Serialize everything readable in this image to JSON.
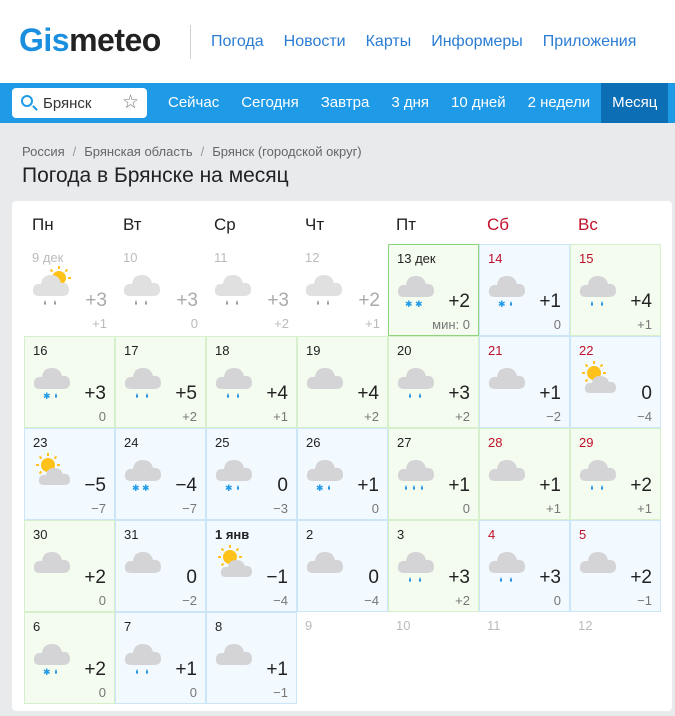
{
  "header": {
    "logo_gis": "Gis",
    "logo_meteo": "meteo",
    "nav": [
      "Погода",
      "Новости",
      "Карты",
      "Информеры",
      "Приложения"
    ]
  },
  "toolbar": {
    "search_value": "Брянск",
    "tabs": [
      "Сейчас",
      "Сегодня",
      "Завтра",
      "3 дня",
      "10 дней",
      "2 недели",
      "Месяц"
    ],
    "active_tab": "Месяц"
  },
  "breadcrumb": [
    "Россия",
    "Брянская область",
    "Брянск (городской округ)"
  ],
  "page_title": "Погода в Брянске на месяц",
  "weekdays": [
    "Пн",
    "Вт",
    "Ср",
    "Чт",
    "Пт",
    "Сб",
    "Вс"
  ],
  "min_label": "мин:",
  "colors": {
    "brand_blue": "#1f9ae6",
    "active_tab": "#0c6fb6",
    "weekend_red": "#c0102a",
    "link_blue": "#2b7cd3"
  },
  "days": [
    {
      "date": "9 дек",
      "tmax": "+3",
      "tmin": "+1",
      "icon": "cloud-sun-rain-icon",
      "state": "past"
    },
    {
      "date": "10",
      "tmax": "+3",
      "tmin": "0",
      "icon": "cloud-rain-icon",
      "state": "past"
    },
    {
      "date": "11",
      "tmax": "+3",
      "tmin": "+2",
      "icon": "cloud-rain-icon",
      "state": "past"
    },
    {
      "date": "12",
      "tmax": "+2",
      "tmin": "+1",
      "icon": "cloud-rain-icon",
      "state": "past"
    },
    {
      "date": "13 дек",
      "tmax": "+2",
      "tmin": "0",
      "icon": "cloud-snow-icon",
      "state": "today"
    },
    {
      "date": "14",
      "tmax": "+1",
      "tmin": "0",
      "icon": "cloud-snow-rain-icon",
      "state": "current",
      "weekend": true
    },
    {
      "date": "15",
      "tmax": "+4",
      "tmin": "+1",
      "icon": "cloud-rain-icon",
      "state": "warm",
      "weekend": true
    },
    {
      "date": "16",
      "tmax": "+3",
      "tmin": "0",
      "icon": "cloud-snow-rain-icon",
      "state": "warm"
    },
    {
      "date": "17",
      "tmax": "+5",
      "tmin": "+2",
      "icon": "cloud-rain-icon",
      "state": "warm"
    },
    {
      "date": "18",
      "tmax": "+4",
      "tmin": "+1",
      "icon": "cloud-rain-icon",
      "state": "warm"
    },
    {
      "date": "19",
      "tmax": "+4",
      "tmin": "+2",
      "icon": "cloud-icon",
      "state": "warm"
    },
    {
      "date": "20",
      "tmax": "+3",
      "tmin": "+2",
      "icon": "cloud-rain-icon",
      "state": "warm"
    },
    {
      "date": "21",
      "tmax": "+1",
      "tmin": "−2",
      "icon": "cloud-icon",
      "state": "current",
      "weekend": true
    },
    {
      "date": "22",
      "tmax": "0",
      "tmin": "−4",
      "icon": "sun-cloud-icon",
      "state": "current",
      "weekend": true
    },
    {
      "date": "23",
      "tmax": "−5",
      "tmin": "−7",
      "icon": "sun-cloud-icon",
      "state": "current"
    },
    {
      "date": "24",
      "tmax": "−4",
      "tmin": "−7",
      "icon": "cloud-snow-icon",
      "state": "current"
    },
    {
      "date": "25",
      "tmax": "0",
      "tmin": "−3",
      "icon": "cloud-snow-rain-icon",
      "state": "current"
    },
    {
      "date": "26",
      "tmax": "+1",
      "tmin": "0",
      "icon": "cloud-snow-rain-icon",
      "state": "current"
    },
    {
      "date": "27",
      "tmax": "+1",
      "tmin": "0",
      "icon": "cloud-heavy-rain-icon",
      "state": "warm"
    },
    {
      "date": "28",
      "tmax": "+1",
      "tmin": "+1",
      "icon": "cloud-icon",
      "state": "warm",
      "weekend": true
    },
    {
      "date": "29",
      "tmax": "+2",
      "tmin": "+1",
      "icon": "cloud-rain-icon",
      "state": "warm",
      "weekend": true
    },
    {
      "date": "30",
      "tmax": "+2",
      "tmin": "0",
      "icon": "cloud-icon",
      "state": "warm"
    },
    {
      "date": "31",
      "tmax": "0",
      "tmin": "−2",
      "icon": "cloud-icon",
      "state": "current"
    },
    {
      "date": "1 янв",
      "tmax": "−1",
      "tmin": "−4",
      "icon": "sun-cloud-icon",
      "state": "current",
      "bold": true
    },
    {
      "date": "2",
      "tmax": "0",
      "tmin": "−4",
      "icon": "cloud-icon",
      "state": "current"
    },
    {
      "date": "3",
      "tmax": "+3",
      "tmin": "+2",
      "icon": "cloud-rain-icon",
      "state": "warm"
    },
    {
      "date": "4",
      "tmax": "+3",
      "tmin": "0",
      "icon": "cloud-rain-icon",
      "state": "current",
      "weekend": true
    },
    {
      "date": "5",
      "tmax": "+2",
      "tmin": "−1",
      "icon": "cloud-icon",
      "state": "current",
      "weekend": true
    },
    {
      "date": "6",
      "tmax": "+2",
      "tmin": "0",
      "icon": "cloud-snow-rain-icon",
      "state": "warm"
    },
    {
      "date": "7",
      "tmax": "+1",
      "tmin": "0",
      "icon": "cloud-rain-icon",
      "state": "current"
    },
    {
      "date": "8",
      "tmax": "+1",
      "tmin": "−1",
      "icon": "cloud-icon",
      "state": "current"
    },
    {
      "date": "9",
      "tmax": "",
      "tmin": "",
      "icon": "",
      "state": "future"
    },
    {
      "date": "10",
      "tmax": "",
      "tmin": "",
      "icon": "",
      "state": "future"
    },
    {
      "date": "11",
      "tmax": "",
      "tmin": "",
      "icon": "",
      "state": "future"
    },
    {
      "date": "12",
      "tmax": "",
      "tmin": "",
      "icon": "",
      "state": "future"
    }
  ]
}
